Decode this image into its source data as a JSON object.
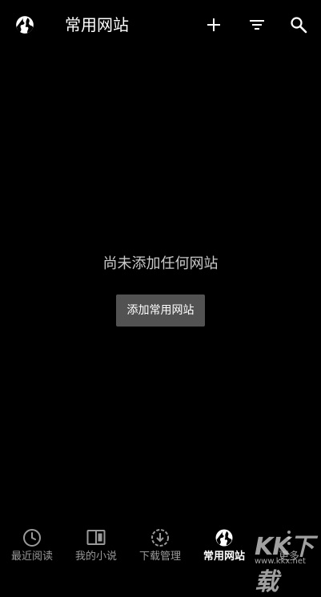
{
  "appbar": {
    "title": "常用网站",
    "icons": {
      "left": "globe-icon",
      "add": "plus-icon",
      "filter": "filter-icon",
      "search": "search-icon"
    }
  },
  "empty_state": {
    "message": "尚未添加任何网站",
    "button_label": "添加常用网站"
  },
  "bottom_nav": {
    "items": [
      {
        "label": "最近阅读",
        "icon": "clock-icon",
        "active": false
      },
      {
        "label": "我的小说",
        "icon": "book-icon",
        "active": false
      },
      {
        "label": "下载管理",
        "icon": "download-icon",
        "active": false
      },
      {
        "label": "常用网站",
        "icon": "globe-icon",
        "active": true
      },
      {
        "label": "更多",
        "icon": "more-vertical-icon",
        "active": false
      }
    ]
  },
  "watermark": {
    "text": "KK下载",
    "url": "www.kkx.net"
  },
  "colors": {
    "background": "#000000",
    "button": "#525252",
    "inactive_label": "#9a9a9a",
    "message": "#c9c9c9"
  }
}
